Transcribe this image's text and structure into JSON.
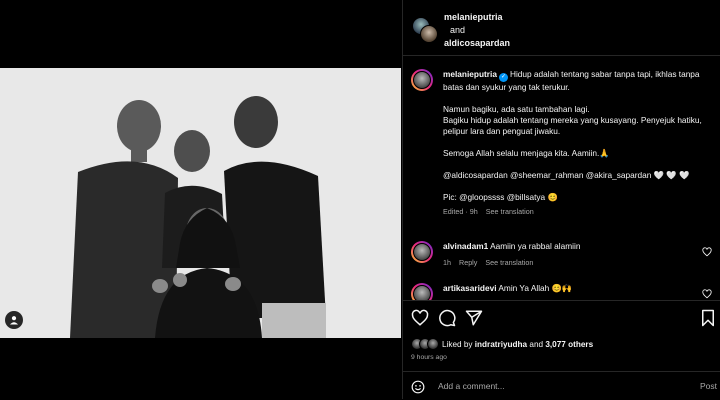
{
  "header": {
    "user1": "melanieputria",
    "and_text": "and",
    "user2": "aldicosapardan"
  },
  "caption": {
    "username": "melanieputria",
    "line1": "Hidup adalah tentang sabar tanpa tapi, ikhlas tanpa batas dan syukur yang tak terukur.",
    "line2": "Namun bagiku, ada satu tambahan lagi.",
    "line3": "Bagiku hidup adalah tentang mereka yang kusayang. Penyejuk hatiku, pelipur lara dan penguat jiwaku.",
    "line4": "Semoga Allah selalu menjaga kita. Aamiin.🙏",
    "line5": "@aldicosapardan @sheemar_rahman @akira_sapardan 🤍 🤍 🤍",
    "line6": "Pic: @gloopssss @billsatya 😊",
    "edited": "Edited · 9h",
    "see_translation": "See translation"
  },
  "comments": [
    {
      "username": "alvinadam1",
      "text": "Aamiin ya rabbal alamiin",
      "time": "1h",
      "reply": "Reply",
      "see_translation": "See translation"
    },
    {
      "username": "artikasaridevi",
      "text": "Amin Ya Allah 😊🙌"
    }
  ],
  "likes": {
    "liked_by": "Liked by",
    "user": "indratriyudha",
    "and_text": "and",
    "others": "3,077 others"
  },
  "time_ago": "9 hours ago",
  "add_comment": {
    "placeholder": "Add a comment...",
    "post_label": "Post"
  },
  "colors": {
    "background": "#000000",
    "text": "#f5f5f5",
    "muted": "#a8a8a8",
    "verified": "#0095f6",
    "divider": "#262626"
  },
  "icons": [
    "tag-user-icon",
    "heart-icon",
    "comment-icon",
    "share-icon",
    "bookmark-icon",
    "emoji-icon",
    "verified-icon"
  ]
}
